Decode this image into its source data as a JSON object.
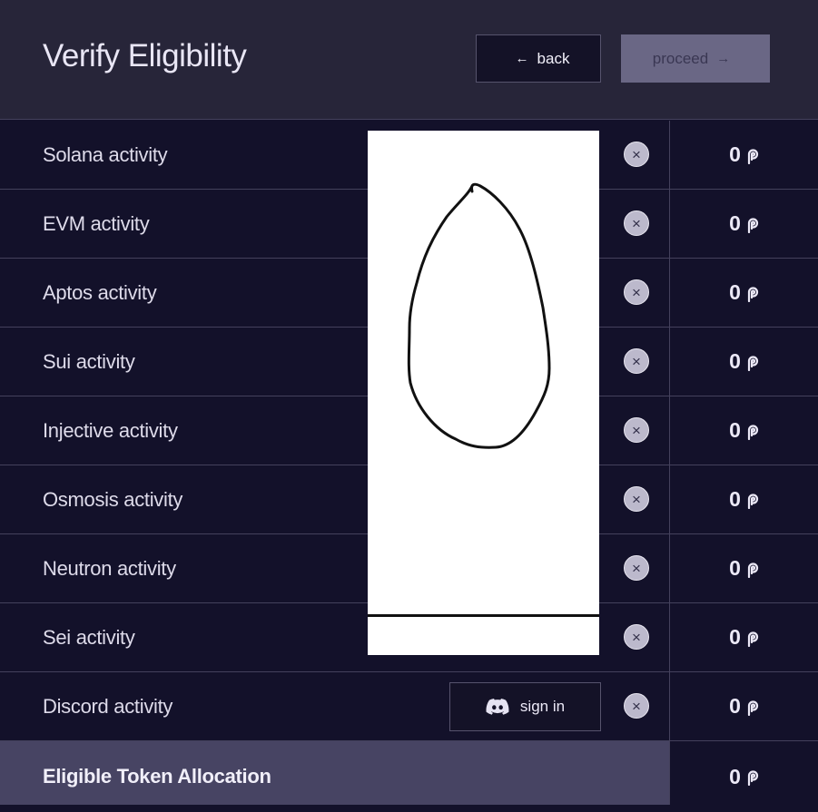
{
  "header": {
    "title": "Verify Eligibility",
    "back_label": "back",
    "proceed_label": "proceed"
  },
  "rows": [
    {
      "label": "Solana activity",
      "points": "0"
    },
    {
      "label": "EVM activity",
      "points": "0"
    },
    {
      "label": "Aptos activity",
      "points": "0"
    },
    {
      "label": "Sui activity",
      "points": "0"
    },
    {
      "label": "Injective activity",
      "points": "0"
    },
    {
      "label": "Osmosis activity",
      "points": "0"
    },
    {
      "label": "Neutron activity",
      "points": "0"
    },
    {
      "label": "Sei activity",
      "points": "0"
    },
    {
      "label": "Discord activity",
      "points": "0",
      "action_label": "sign in"
    }
  ],
  "footer": {
    "label": "Eligible Token Allocation",
    "points": "0"
  },
  "colors": {
    "background": "#13112a",
    "header": "#272539",
    "footer": "#474463",
    "proceed_disabled": "#6a6785",
    "clear_button": "#bcb9cc"
  },
  "icons": {
    "back": "arrow-left-icon",
    "proceed": "arrow-right-icon",
    "clear": "close-circle-icon",
    "points": "token-p-icon",
    "discord": "discord-icon"
  }
}
